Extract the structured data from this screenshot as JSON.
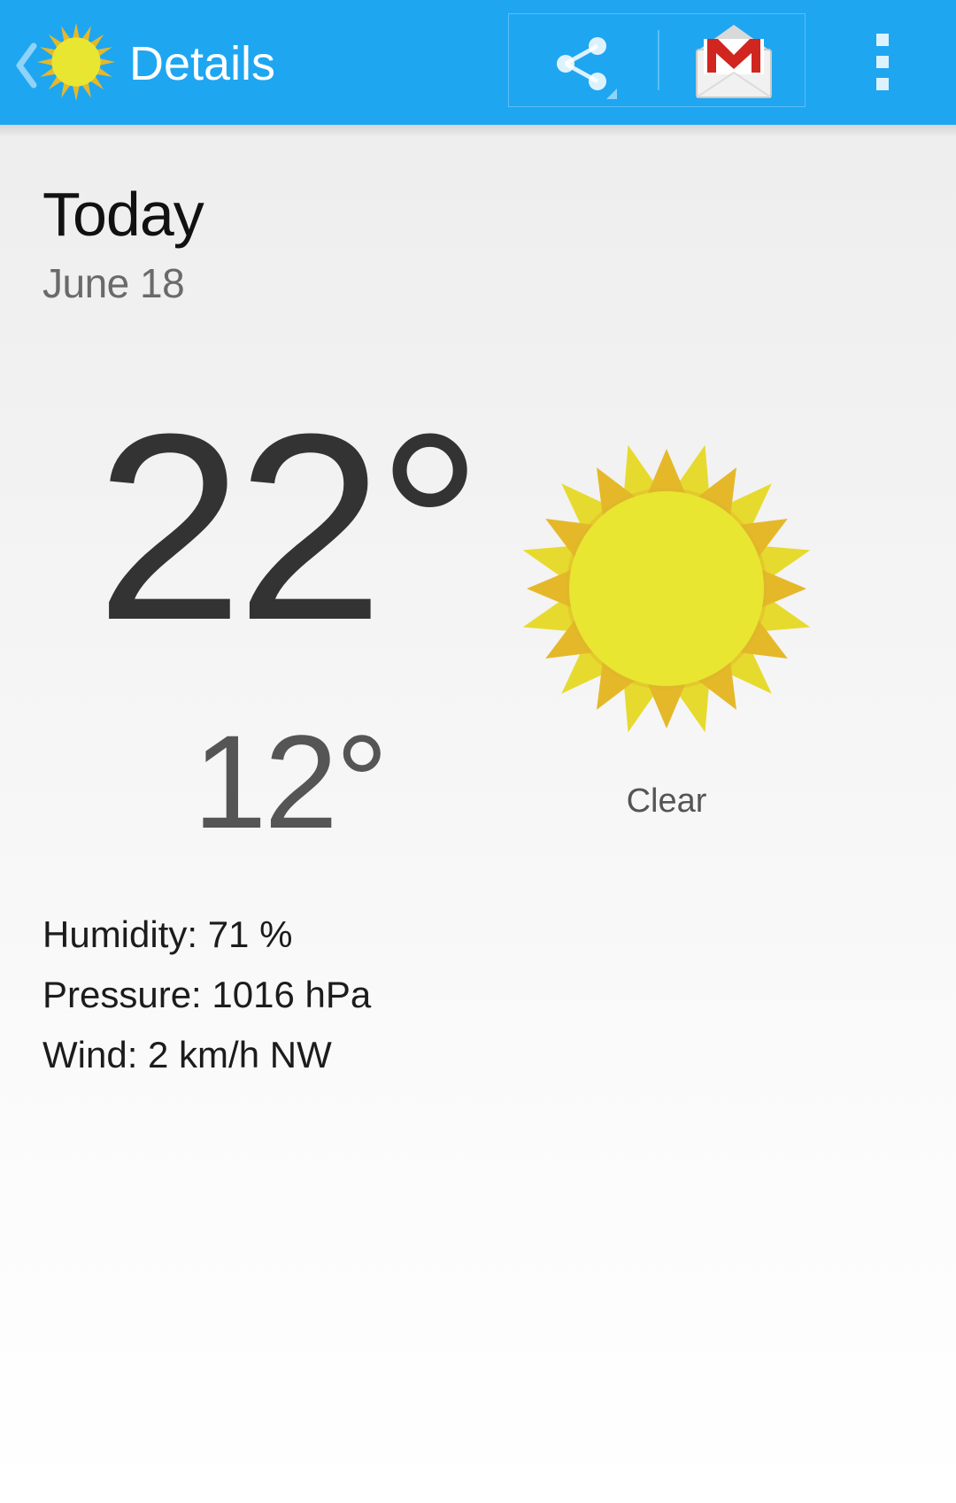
{
  "action_bar": {
    "title": "Details",
    "app_icon": "sun-icon",
    "back_icon": "chevron-left-icon",
    "actions": [
      {
        "name": "share",
        "icon": "share-icon"
      },
      {
        "name": "gmail",
        "icon": "gmail-icon"
      },
      {
        "name": "overflow",
        "icon": "overflow-menu-icon"
      }
    ],
    "colors": {
      "bar": "#1ea6f1",
      "text": "#ffffff"
    }
  },
  "forecast": {
    "day": "Today",
    "date": "June 18",
    "high": "22°",
    "low": "12°",
    "condition": "Clear",
    "condition_icon": "clear-sun-icon",
    "humidity": "Humidity: 71 %",
    "pressure": "Pressure: 1016 hPa",
    "wind": "Wind: 2 km/h NW"
  },
  "colors": {
    "sun_core": "#e8e631",
    "sun_rays_light": "#e7da2e",
    "sun_rays_dark": "#e5b82a"
  }
}
